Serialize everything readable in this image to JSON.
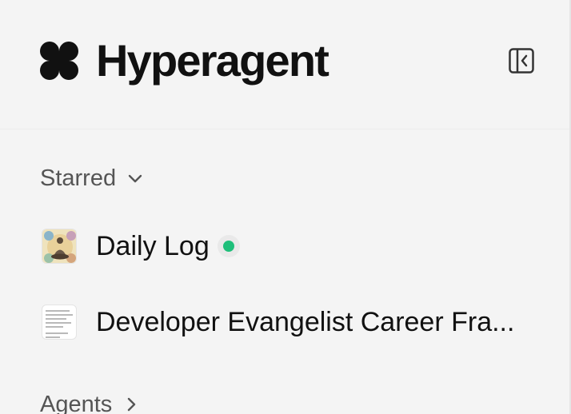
{
  "brand": {
    "name": "Hyperagent",
    "logo_icon": "four-petal-logo-icon",
    "color": "#111111"
  },
  "header": {
    "collapse_icon": "sidebar-collapse-icon"
  },
  "sections": {
    "starred": {
      "label": "Starred",
      "icon": "chevron-down-icon",
      "expanded": true,
      "items": [
        {
          "label": "Daily Log",
          "thumbnail": "meditation-illustration-thumbnail",
          "status": "active",
          "status_color": "#1fbf7a"
        },
        {
          "label": "Developer Evangelist Career Framework",
          "display_label": "Developer Evangelist Career Fra...",
          "thumbnail": "document-thumbnail"
        }
      ]
    },
    "agents": {
      "label": "Agents",
      "icon": "chevron-right-icon",
      "expanded": false
    }
  },
  "colors": {
    "background": "#f4f4f4",
    "text_primary": "#111111",
    "text_secondary": "#555555",
    "active_dot": "#1fbf7a"
  }
}
